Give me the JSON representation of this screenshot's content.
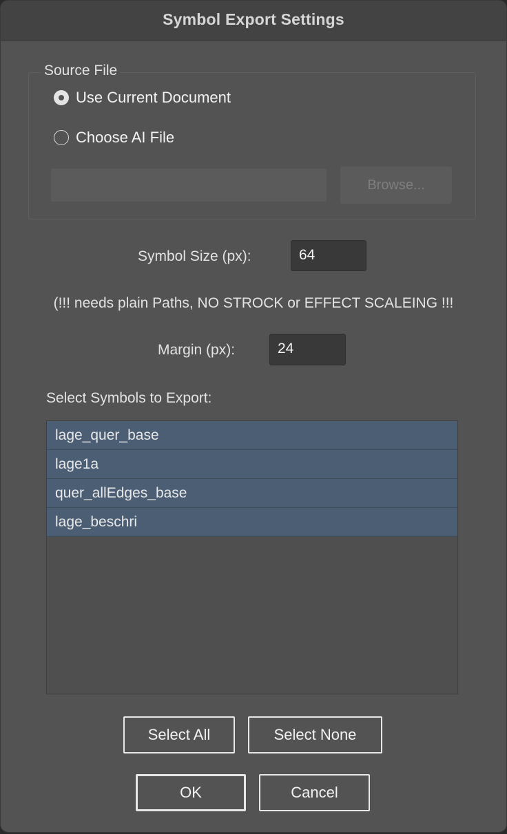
{
  "window": {
    "title": "Symbol Export Settings"
  },
  "source_file": {
    "label": "Source File",
    "options": [
      {
        "label": "Use Current Document",
        "checked": true
      },
      {
        "label": "Choose AI File",
        "checked": false
      }
    ],
    "path_value": "",
    "browse_label": "Browse..."
  },
  "symbol_size": {
    "label": "Symbol Size (px):",
    "value": "64"
  },
  "warning": "(!!! needs plain Paths, NO STROCK or EFFECT SCALEING !!!",
  "margin": {
    "label": "Margin (px):",
    "value": "24"
  },
  "symbols": {
    "label": "Select Symbols to Export:",
    "items": [
      "lage_quer_base",
      "lage1a",
      "quer_allEdges_base",
      "lage_beschri"
    ]
  },
  "buttons": {
    "select_all": "Select All",
    "select_none": "Select None",
    "ok": "OK",
    "cancel": "Cancel"
  },
  "colors": {
    "dialog_bg": "#535353",
    "selection": "#4b5e74"
  }
}
